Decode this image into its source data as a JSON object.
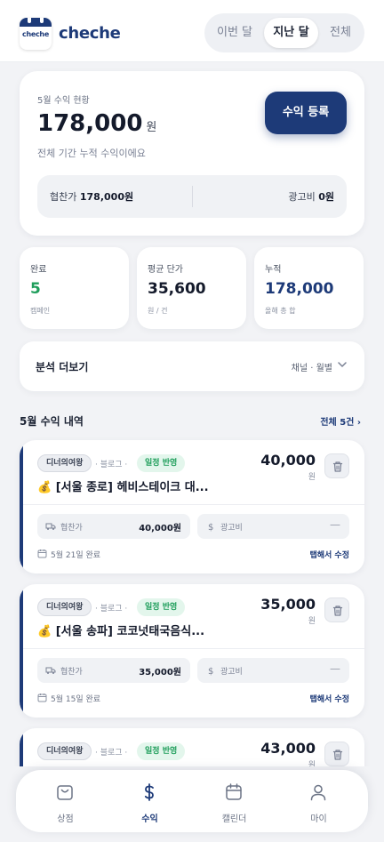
{
  "app": {
    "name": "cheche",
    "logo_text": "cheche"
  },
  "period_tabs": [
    {
      "label": "이번 달",
      "active": false
    },
    {
      "label": "지난 달",
      "active": true
    },
    {
      "label": "전체",
      "active": false
    }
  ],
  "summary": {
    "label": "5월 수익 현황",
    "value": "178,000",
    "unit": "원",
    "sub": "전체 기간 누적 수익이에요",
    "register_label": "수익 등록",
    "sponsor_label": "협찬가",
    "sponsor_value": "178,000원",
    "ad_label": "광고비",
    "ad_value": "0원"
  },
  "stats": [
    {
      "label": "완료",
      "value": "5",
      "sub": "캠페인",
      "color": "#1f9e5b"
    },
    {
      "label": "평균 단가",
      "value": "35,600",
      "sub": "원 / 건",
      "color": "#141a2b"
    },
    {
      "label": "누적",
      "value": "178,000",
      "sub": "올해 총 합",
      "color": "#1d3a78"
    }
  ],
  "analysis": {
    "title": "분석 더보기",
    "sub": "채널 · 월별"
  },
  "section": {
    "title": "5월 수익 내역",
    "link": "전체 5건 ›"
  },
  "items": [
    {
      "category": "디너의여왕",
      "channel": "· 블로그 ·",
      "status": "일정 반영",
      "title": "💰 [서울 종로] 헤비스테이크 대...",
      "amount": "40,000",
      "unit": "원",
      "sponsor_label": "협찬가",
      "sponsor_value": "40,000원",
      "ad_label": "광고비",
      "ad_value": "—",
      "date": "5월 21일 완료",
      "edit": "탭해서 수정"
    },
    {
      "category": "디너의여왕",
      "channel": "· 블로그 ·",
      "status": "일정 반영",
      "title": "💰 [서울 송파] 코코넛태국음식...",
      "amount": "35,000",
      "unit": "원",
      "sponsor_label": "협찬가",
      "sponsor_value": "35,000원",
      "ad_label": "광고비",
      "ad_value": "—",
      "date": "5월 15일 완료",
      "edit": "탭해서 수정"
    },
    {
      "category": "디너의여왕",
      "channel": "· 블로그 ·",
      "status": "일정 반영",
      "title": "",
      "amount": "43,000",
      "unit": "원"
    }
  ],
  "nav": [
    {
      "label": "상점",
      "icon": "bag-icon",
      "active": false
    },
    {
      "label": "수익",
      "icon": "dollar-icon",
      "active": true
    },
    {
      "label": "캘린더",
      "icon": "calendar-icon",
      "active": false
    },
    {
      "label": "마이",
      "icon": "person-icon",
      "active": false
    }
  ],
  "colors": {
    "brand": "#1d3a78",
    "success": "#1f9e5b",
    "background": "#f2f3f6"
  }
}
